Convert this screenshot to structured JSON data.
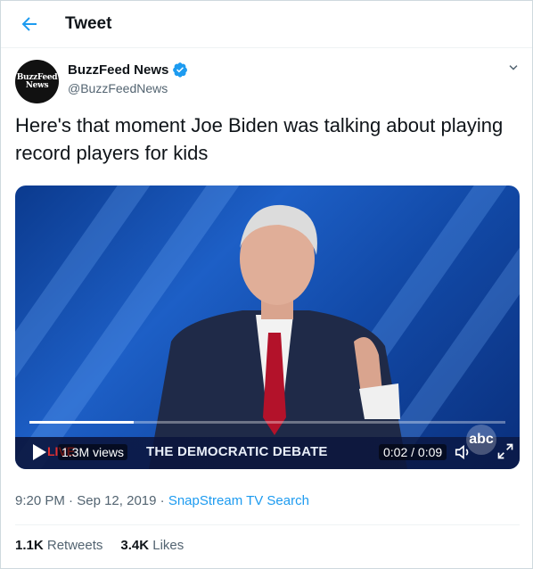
{
  "header": {
    "title": "Tweet"
  },
  "author": {
    "avatar_line1": "BuzzFeed",
    "avatar_line2": "News",
    "name": "BuzzFeed News",
    "handle": "@BuzzFeedNews",
    "verified": true
  },
  "tweet": {
    "text": "Here's that moment Joe Biden was talking about playing record players for kids"
  },
  "video": {
    "views": "1.3M views",
    "live_tag": "LIVE",
    "lower_third": "THE DEMOCRATIC DEBATE",
    "timecode": "0:02 / 0:09",
    "network_logo": "abc",
    "progress": 0.22
  },
  "meta": {
    "time": "9:20 PM",
    "date": "Sep 12, 2019",
    "separator": "·",
    "source": "SnapStream TV Search"
  },
  "stats": {
    "retweets_count": "1.1K",
    "retweets_label": "Retweets",
    "likes_count": "3.4K",
    "likes_label": "Likes"
  },
  "colors": {
    "accent": "#1d9bf0",
    "text": "#0f1419",
    "muted": "#536471"
  }
}
